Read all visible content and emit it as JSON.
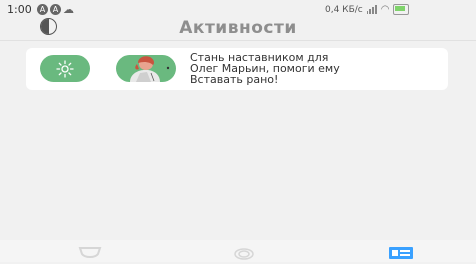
{
  "status_bar": {
    "time": "1:00",
    "net_speed": "0,4 КБ/с",
    "icons": [
      "notification-a-icon",
      "notification-a-icon",
      "cloud-icon",
      "signal-icon",
      "wifi-icon",
      "battery-icon"
    ]
  },
  "header": {
    "title": "Активности",
    "toggle_icon": "contrast-icon"
  },
  "activity_card": {
    "line1": "Стань наставником для",
    "line2": "Олег Марьин, помоги ему",
    "line3": "Вставать рано!",
    "icons": [
      "sun-icon",
      "avatar"
    ]
  },
  "bottom_nav": {
    "items": [
      {
        "icon": "award-icon",
        "active": false
      },
      {
        "icon": "ring-icon",
        "active": false
      },
      {
        "icon": "activity-icon",
        "active": true
      }
    ]
  },
  "colors": {
    "accent": "#6ab97f",
    "active_nav": "#3aa1ff",
    "inactive_nav": "#d6d6d6"
  }
}
